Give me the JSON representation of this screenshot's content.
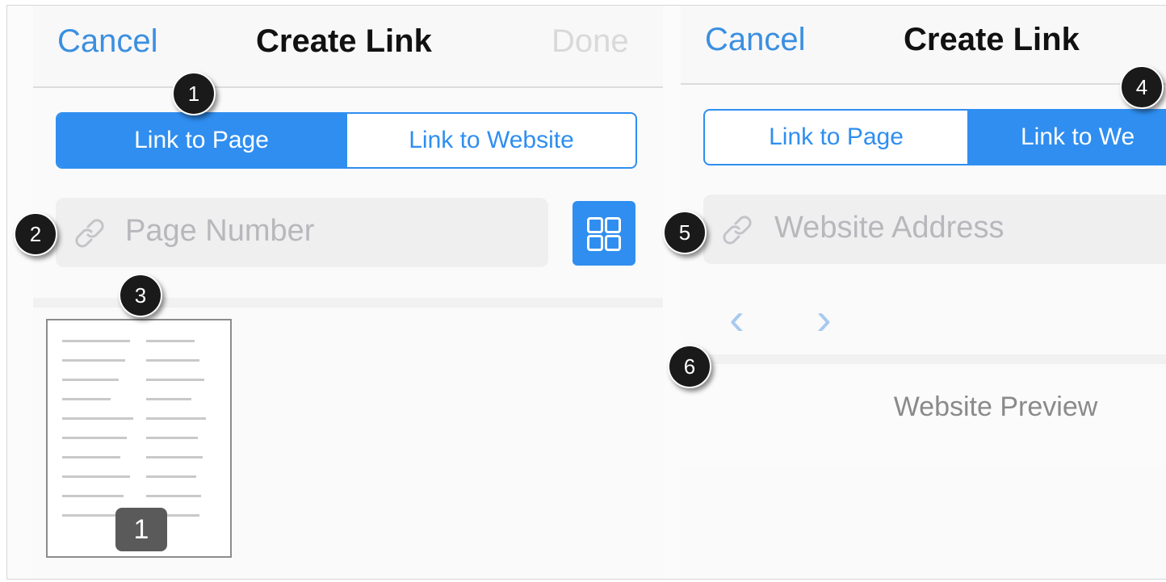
{
  "left_screen": {
    "nav": {
      "cancel": "Cancel",
      "title": "Create Link",
      "done": "Done"
    },
    "tabs": [
      {
        "label": "Link to Page",
        "active": true
      },
      {
        "label": "Link to Website",
        "active": false
      }
    ],
    "input": {
      "placeholder": "Page Number",
      "icon": "link-icon"
    },
    "grid_button_icon": "grid-icon",
    "thumbnail": {
      "page_badge": "1"
    }
  },
  "right_screen": {
    "nav": {
      "cancel": "Cancel",
      "title": "Create Link"
    },
    "tabs": [
      {
        "label": "Link to Page",
        "active": false
      },
      {
        "label": "Link to We",
        "active": true
      }
    ],
    "input": {
      "placeholder": "Website Address",
      "icon": "link-icon"
    },
    "back_icon": "chevron-left-icon",
    "forward_icon": "chevron-right-icon",
    "preview_text": "Website Preview"
  },
  "callouts": [
    "1",
    "2",
    "3",
    "4",
    "5",
    "6"
  ],
  "colors": {
    "accent": "#2f8ef0",
    "cancel": "#3b8fe0",
    "callout": "#1a1a1a"
  }
}
